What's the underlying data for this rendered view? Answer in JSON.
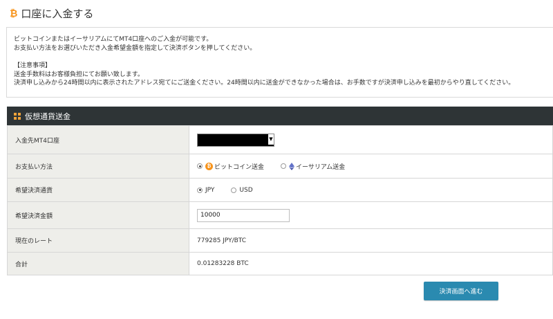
{
  "page": {
    "title": "口座に入金する",
    "title_icon": "bitcoin-icon",
    "accent_color": "#f7931a"
  },
  "notice": {
    "line1": "ビットコインまたはイーサリアムにてMT4口座へのご入金が可能です。",
    "line2": "お支払い方法をお選びいただき入金希望金額を指定して決済ボタンを押してください。",
    "caution_heading": "【注意事項】",
    "caution1": "送金手数料はお客様負担にてお願い致します。",
    "caution2": "決済申し込みから24時間以内に表示されたアドレス宛てにご送金ください。24時間以内に送金ができなかった場合は、お手数ですが決済申し込みを最初からやり直してください。"
  },
  "section": {
    "title": "仮想通貨送金",
    "icon": "grid-icon",
    "header_color": "#2e3436"
  },
  "form": {
    "account": {
      "label": "入金先MT4口座",
      "selected": ""
    },
    "payment_method": {
      "label": "お支払い方法",
      "options": [
        {
          "label": "ビットコイン送金",
          "checked": true,
          "icon": "bitcoin-icon"
        },
        {
          "label": "イーサリアム送金",
          "checked": false,
          "icon": "ethereum-icon"
        }
      ]
    },
    "currency": {
      "label": "希望決済通貨",
      "options": [
        {
          "label": "JPY",
          "checked": true
        },
        {
          "label": "USD",
          "checked": false
        }
      ]
    },
    "amount": {
      "label": "希望決済金額",
      "value": "10000"
    },
    "rate": {
      "label": "現在のレート",
      "value": "779285 JPY/BTC"
    },
    "total": {
      "label": "合計",
      "value": "0.01283228 BTC"
    }
  },
  "submit": {
    "label": "決済画面へ進む",
    "color": "#2a8ab0"
  }
}
